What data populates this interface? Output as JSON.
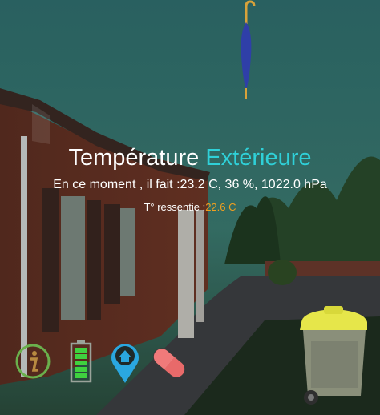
{
  "weather": {
    "title_prefix": "Température",
    "title_accent": "Extérieure",
    "current_label": "En ce moment , il fait :",
    "current_values": "23.2 C, 36 %, 1022.0 hPa",
    "feels_label": "T° ressentie :",
    "feels_value": "22.6 C"
  },
  "icons": {
    "top": "umbrella-icon",
    "bottom": [
      "info-icon",
      "battery-icon",
      "home-location-icon",
      "pill-icon",
      "trash-bin-icon"
    ]
  },
  "colors": {
    "accent": "#2fd0d8",
    "feels": "#f0a020",
    "info": "#6ab04c",
    "battery": "#3fd23f",
    "location": "#2aa7e0",
    "pill": "#e86a6a",
    "bin_lid": "#e6e64a",
    "bin_body": "#8a8f7a"
  }
}
